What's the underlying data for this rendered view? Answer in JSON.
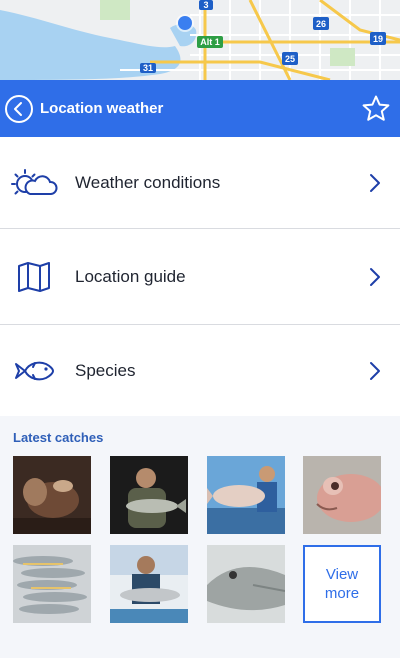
{
  "map": {
    "road_badges": [
      "3",
      "26",
      "19",
      "Alt 1",
      "25",
      "31"
    ]
  },
  "header": {
    "title": "Location weather",
    "back_icon": "chevron-left-circle-icon",
    "favorite_icon": "star-outline-icon",
    "color": "#2f6ee8"
  },
  "menu": {
    "items": [
      {
        "label": "Weather conditions",
        "icon": "sun-cloud-icon"
      },
      {
        "label": "Location guide",
        "icon": "map-icon"
      },
      {
        "label": "Species",
        "icon": "fish-icon"
      }
    ]
  },
  "catches": {
    "title": "Latest catches",
    "view_more_label": "View more",
    "photos": [
      "catch-photo-1",
      "catch-photo-2",
      "catch-photo-3",
      "catch-photo-4",
      "catch-photo-5",
      "catch-photo-6",
      "catch-photo-7"
    ]
  }
}
